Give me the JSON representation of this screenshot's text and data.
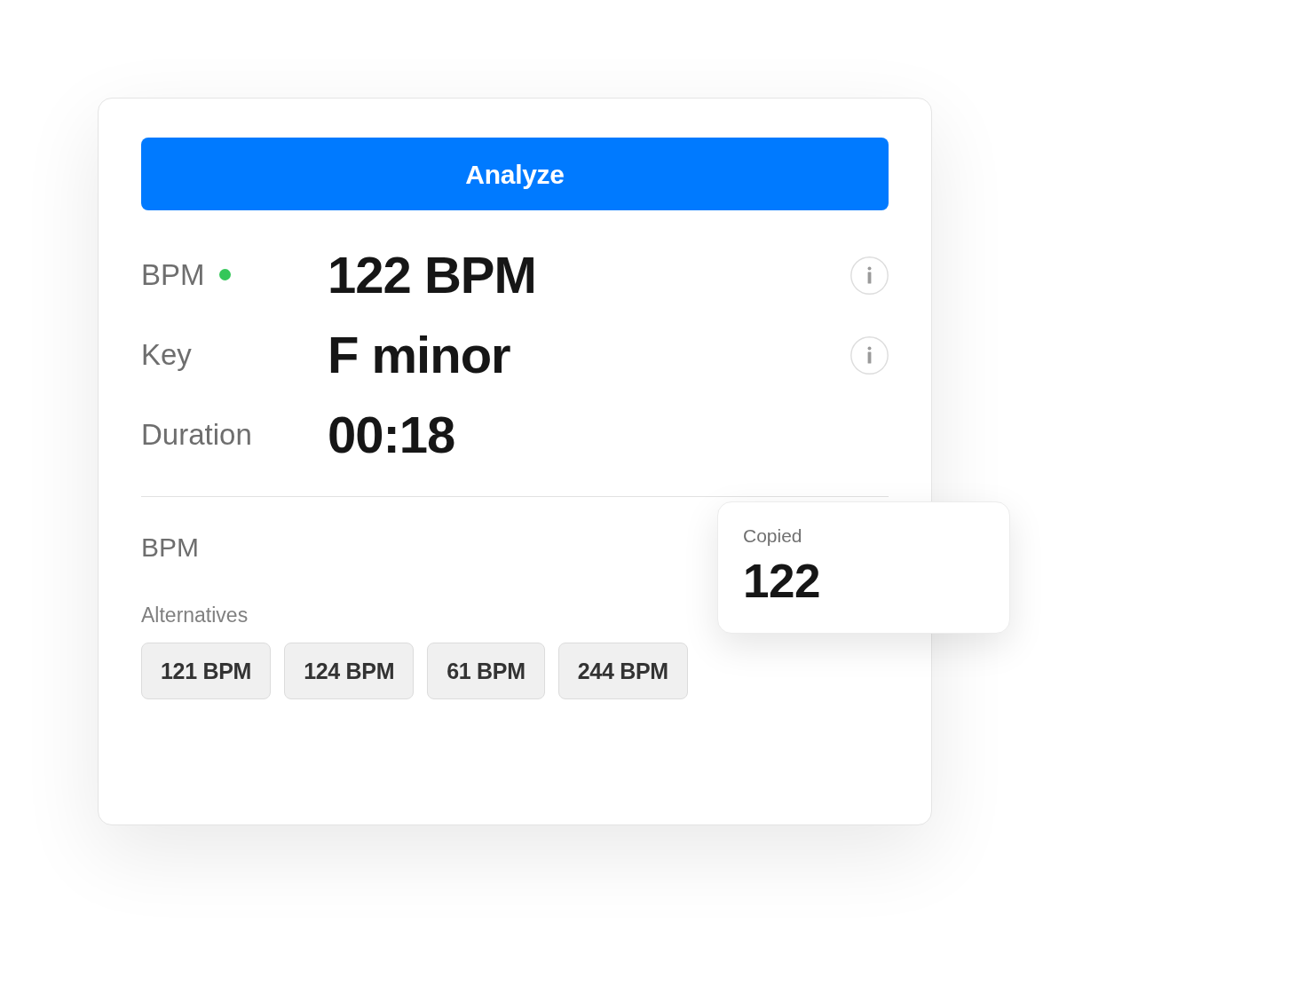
{
  "analyze_button": {
    "label": "Analyze"
  },
  "results": [
    {
      "label": "BPM",
      "value": "122 BPM",
      "color": "#34c759",
      "info": true
    },
    {
      "label": "Key",
      "value": "F minor",
      "info": true
    },
    {
      "label": "Duration",
      "value": "00:18",
      "info": false
    }
  ],
  "bpm_section": {
    "title": "BPM",
    "alternatives_label": "Alternatives",
    "alternatives": [
      "121 BPM",
      "124 BPM",
      "61 BPM",
      "244 BPM"
    ]
  },
  "toast": {
    "label": "Copied",
    "value": "122"
  }
}
